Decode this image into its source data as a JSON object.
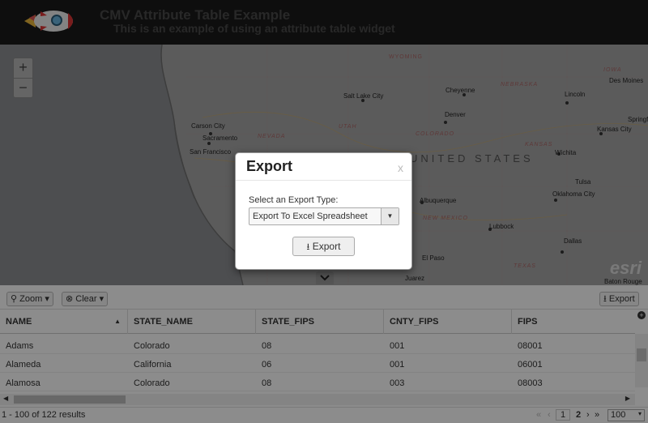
{
  "header": {
    "title": "CMV Attribute Table Example",
    "subtitle": "This is an example of using an attribute table widget"
  },
  "map": {
    "zoom_in": "+",
    "zoom_out": "−",
    "attribution": "esri",
    "cities": [
      "Salt Lake City",
      "Cheyenne",
      "Denver",
      "Carson City",
      "Sacramento",
      "San Francisco",
      "Lincoln",
      "Des Moines",
      "Kansas City",
      "Wichita",
      "Tulsa",
      "Oklahoma City",
      "Albuquerque",
      "Lubbock",
      "El Paso",
      "Juarez",
      "Dallas",
      "Springfield",
      "Baton Rouge"
    ],
    "regions": [
      "WYOMING",
      "NEBRASKA",
      "IOWA",
      "NEVADA",
      "UTAH",
      "COLORADO",
      "KANSAS",
      "NEW MEXICO",
      "TEXAS"
    ],
    "country_label": "UNITED STATES"
  },
  "toolbar": {
    "zoom_label": "Zoom",
    "clear_label": "Clear",
    "export_label": "Export"
  },
  "table": {
    "columns": [
      "NAME",
      "STATE_NAME",
      "STATE_FIPS",
      "CNTY_FIPS",
      "FIPS"
    ],
    "rows": [
      [
        "Adams",
        "Colorado",
        "08",
        "001",
        "08001"
      ],
      [
        "Alameda",
        "California",
        "06",
        "001",
        "06001"
      ],
      [
        "Alamosa",
        "Colorado",
        "08",
        "003",
        "08003"
      ]
    ],
    "results_text": "1 - 100 of 122 results",
    "pages": [
      "1",
      "2"
    ],
    "page_size": "100"
  },
  "modal": {
    "title": "Export",
    "close": "x",
    "label": "Select an Export Type:",
    "selected_type": "Export To Excel Spreadsheet",
    "button_label": "Export"
  }
}
